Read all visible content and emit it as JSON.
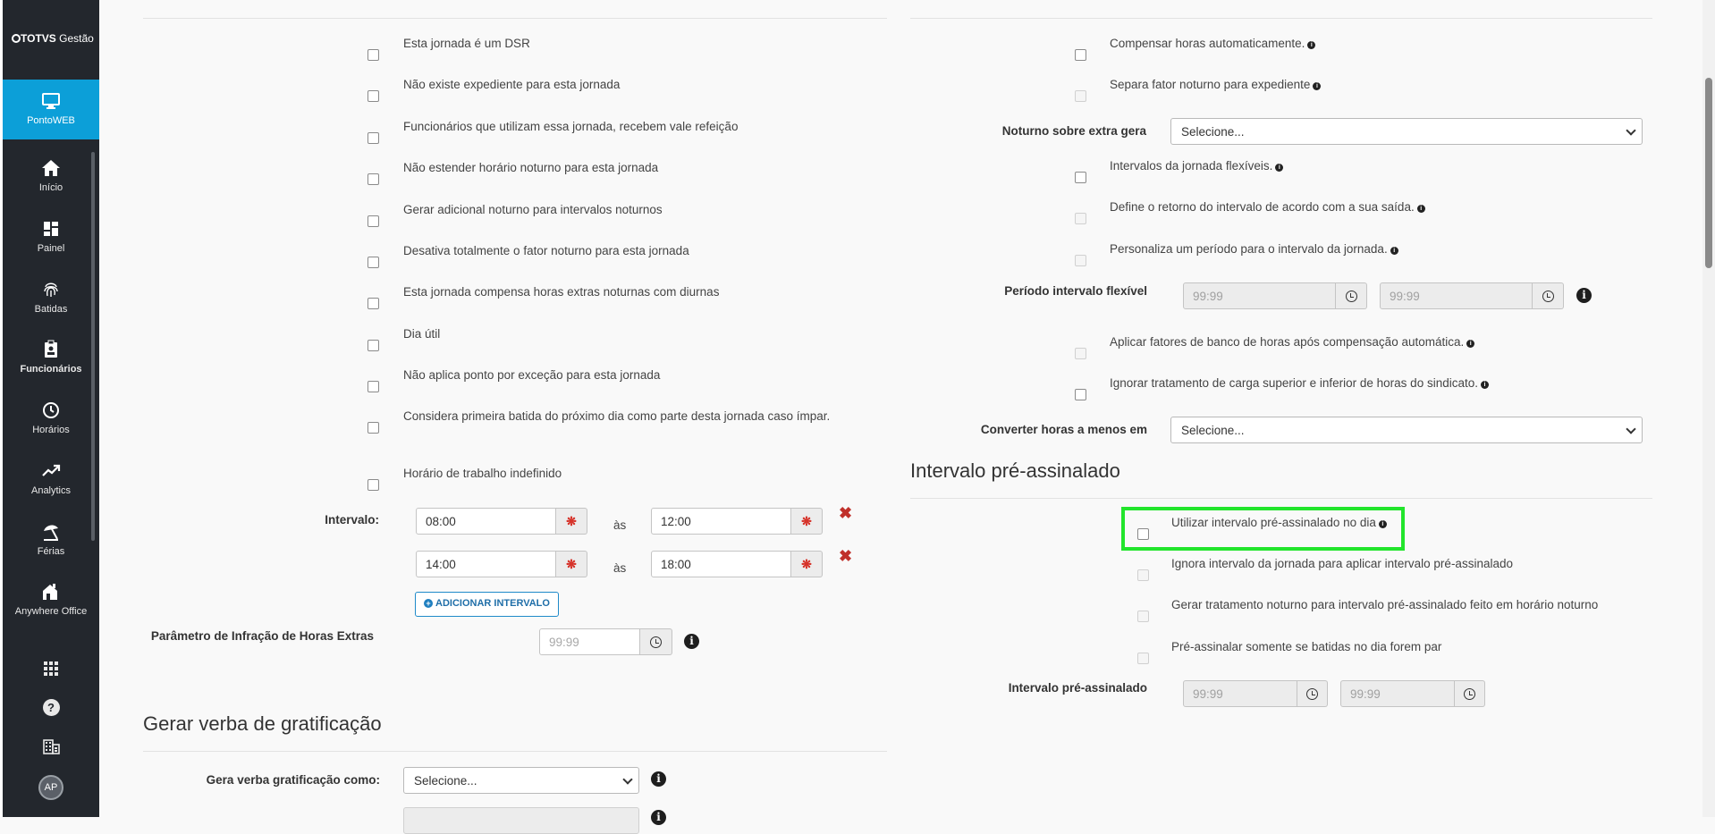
{
  "app": {
    "logo_brand": "TOTVS",
    "logo_product": "Gestão"
  },
  "sidebar": {
    "items": [
      {
        "label": "PontoWEB",
        "icon": "monitor-icon",
        "active": true
      },
      {
        "label": "Início",
        "icon": "home-icon"
      },
      {
        "label": "Painel",
        "icon": "dashboard-icon"
      },
      {
        "label": "Batidas",
        "icon": "fingerprint-icon"
      },
      {
        "label": "Funcionários",
        "icon": "badge-icon"
      },
      {
        "label": "Horários",
        "icon": "clock-icon"
      },
      {
        "label": "Analytics",
        "icon": "trending-icon"
      },
      {
        "label": "Férias",
        "icon": "beach-umbrella-icon"
      },
      {
        "label": "Anywhere Office",
        "icon": "home-office-icon"
      }
    ],
    "bottom": {
      "apps_icon": "grid-icon",
      "help_icon": "help-icon",
      "company_icon": "building-icon",
      "avatar_initials": "AP"
    }
  },
  "left": {
    "checkboxes": [
      "Esta jornada é um DSR",
      "Não existe expediente para esta jornada",
      "Funcionários que utilizam essa jornada, recebem vale refeição",
      "Não estender horário noturno para esta jornada",
      "Gerar adicional noturno para intervalos noturnos",
      "Desativa totalmente o fator noturno para esta jornada",
      "Esta jornada compensa horas extras noturnas com diurnas",
      "Dia útil",
      "Não aplica ponto por exceção para esta jornada",
      "Considera primeira batida do próximo dia como parte desta jornada caso ímpar.",
      "Horário de trabalho indefinido"
    ],
    "interval_label": "Intervalo:",
    "intervals": [
      {
        "start": "08:00",
        "end": "12:00"
      },
      {
        "start": "14:00",
        "end": "18:00"
      }
    ],
    "as_text": "às",
    "add_interval_button": "ADICIONAR INTERVALO",
    "overtime_param_label": "Parâmetro de Infração de Horas Extras",
    "overtime_param_placeholder": "99:99",
    "gratification_title": "Gerar verba de gratificação",
    "gratification_label": "Gera verba gratificação como:",
    "gratification_select": "Selecione..."
  },
  "right": {
    "checkboxes_top": [
      {
        "label": "Compensar horas automaticamente.",
        "info": true,
        "disabled": false
      },
      {
        "label": "Separa fator noturno para expediente",
        "info": true,
        "disabled": true
      }
    ],
    "noturno_label": "Noturno sobre extra gera",
    "noturno_select": "Selecione...",
    "checkboxes_mid": [
      {
        "label": "Intervalos da jornada flexíveis.",
        "info": true,
        "disabled": false
      },
      {
        "label": "Define o retorno do intervalo de acordo com a sua saída.",
        "info": true,
        "disabled": true
      },
      {
        "label": "Personaliza um período para o intervalo da jornada.",
        "info": true,
        "disabled": true
      }
    ],
    "flex_period_label": "Período intervalo flexível",
    "flex_from": "99:99",
    "flex_to": "99:99",
    "checkboxes_low": [
      {
        "label": "Aplicar fatores de banco de horas após compensação automática.",
        "info": true,
        "disabled": true
      },
      {
        "label": "Ignorar tratamento de carga superior e inferior de horas do sindicato.",
        "info": true,
        "disabled": false
      }
    ],
    "convert_label": "Converter horas a menos em",
    "convert_select": "Selecione...",
    "pre_title": "Intervalo pré-assinalado",
    "pre_checkboxes": [
      {
        "label": "Utilizar intervalo pré-assinalado no dia",
        "info": true,
        "disabled": false
      },
      {
        "label": "Ignora intervalo da jornada para aplicar intervalo pré-assinalado",
        "info": false,
        "disabled": true
      },
      {
        "label": "Gerar tratamento noturno para intervalo pré-assinalado feito em horário noturno",
        "info": false,
        "disabled": true
      },
      {
        "label": "Pré-assinalar somente se batidas no dia forem par",
        "info": false,
        "disabled": true
      }
    ],
    "pre_label": "Intervalo pré-assinalado",
    "pre_from": "99:99",
    "pre_to": "99:99"
  },
  "colors": {
    "sidebar_bg": "#23272d",
    "active_nav": "#0c9fd8",
    "highlight": "#22e52c",
    "required": "#d6332a"
  }
}
